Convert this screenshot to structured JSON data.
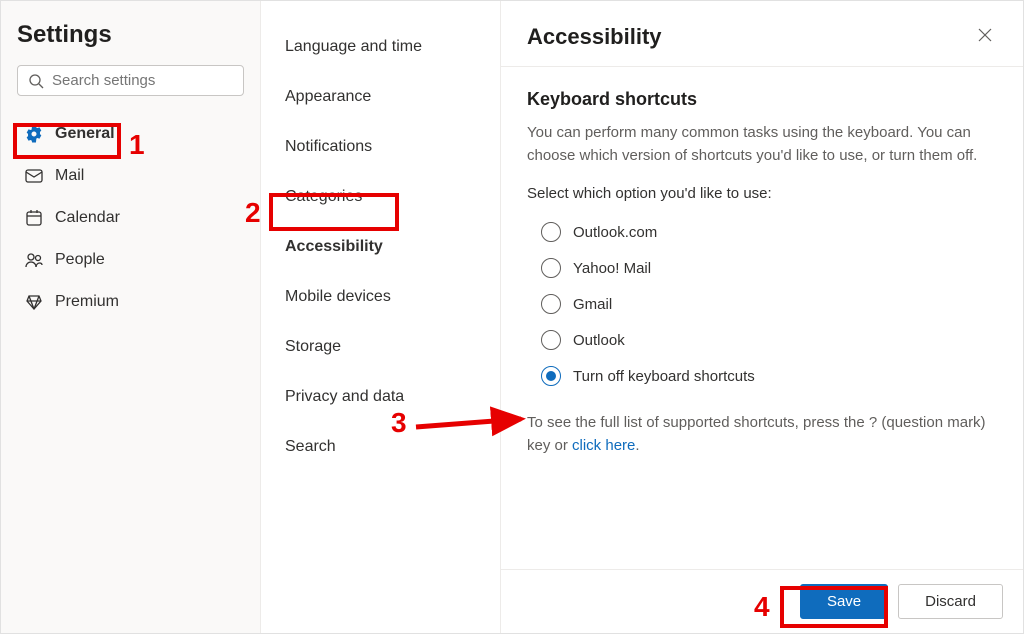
{
  "title": "Settings",
  "search": {
    "placeholder": "Search settings"
  },
  "leftNav": {
    "items": [
      {
        "label": "General",
        "active": true
      },
      {
        "label": "Mail"
      },
      {
        "label": "Calendar"
      },
      {
        "label": "People"
      },
      {
        "label": "Premium"
      }
    ]
  },
  "midNav": {
    "items": [
      {
        "label": "Language and time"
      },
      {
        "label": "Appearance"
      },
      {
        "label": "Notifications"
      },
      {
        "label": "Categories"
      },
      {
        "label": "Accessibility",
        "active": true
      },
      {
        "label": "Mobile devices"
      },
      {
        "label": "Storage"
      },
      {
        "label": "Privacy and data"
      },
      {
        "label": "Search"
      }
    ]
  },
  "panel": {
    "title": "Accessibility",
    "section_title": "Keyboard shortcuts",
    "description": "You can perform many common tasks using the keyboard. You can choose which version of shortcuts you'd like to use, or turn them off.",
    "prompt": "Select which option you'd like to use:",
    "options": [
      {
        "label": "Outlook.com",
        "checked": false
      },
      {
        "label": "Yahoo! Mail",
        "checked": false
      },
      {
        "label": "Gmail",
        "checked": false
      },
      {
        "label": "Outlook",
        "checked": false
      },
      {
        "label": "Turn off keyboard shortcuts",
        "checked": true
      }
    ],
    "hint_prefix": "To see the full list of supported shortcuts, press the ? (question mark) key or ",
    "hint_link": "click here",
    "hint_suffix": "."
  },
  "footer": {
    "save": "Save",
    "discard": "Discard"
  },
  "annotations": {
    "n1": "1",
    "n2": "2",
    "n3": "3",
    "n4": "4"
  }
}
